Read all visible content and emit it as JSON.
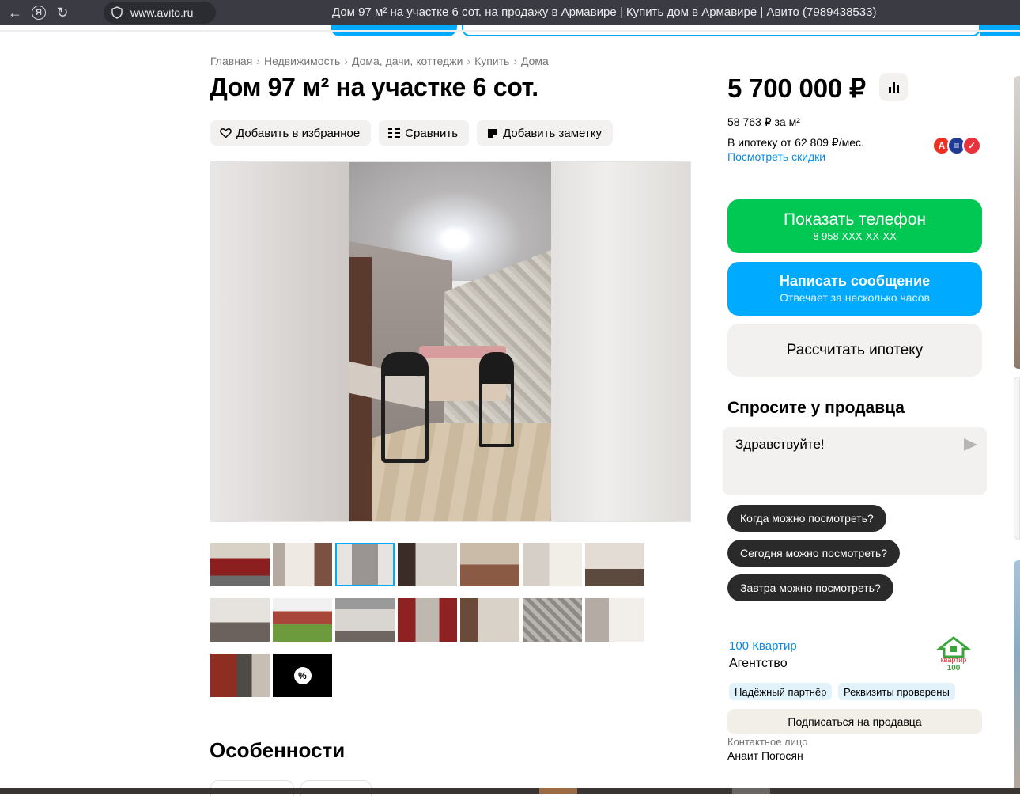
{
  "browser": {
    "url": "www.avito.ru",
    "tab_title": "Дом 97 м² на участке 6 сот. на продажу в Армавире | Купить дом в Армавире | Авито (7989438533)"
  },
  "breadcrumbs": [
    "Главная",
    "Недвижимость",
    "Дома, дачи, коттеджи",
    "Купить",
    "Дома"
  ],
  "listing": {
    "title": "Дом 97 м² на участке 6 сот.",
    "actions": {
      "favorite": "Добавить в избранное",
      "compare": "Сравнить",
      "note": "Добавить заметку"
    },
    "features_heading": "Особенности"
  },
  "price": {
    "value": "5 700 000 ₽",
    "per_m2": "58 763 ₽ за м²",
    "mortgage": "В ипотеку от 62 809 ₽/мес.",
    "discounts_link": "Посмотреть скидки"
  },
  "contact_buttons": {
    "phone_label": "Показать телефон",
    "phone_number": "8 958 XXX-XX-XX",
    "message_label": "Написать сообщение",
    "message_sub": "Отвечает за несколько часов",
    "mortgage_calc": "Рассчитать ипотеку"
  },
  "ask_seller": {
    "title": "Спросите у продавца",
    "message_value": "Здравствуйте!",
    "quick_questions": [
      "Когда можно посмотреть?",
      "Сегодня можно посмотреть?",
      "Завтра можно посмотреть?"
    ]
  },
  "seller": {
    "name": "100 Квартир",
    "type": "Агентство",
    "badges": [
      "Надёжный партнёр",
      "Реквизиты проверены"
    ],
    "subscribe": "Подписаться на продавца",
    "contact_label": "Контактное лицо",
    "contact_name": "Анаит Погосян",
    "logo_text_1": "квартир",
    "logo_text_2": "100"
  },
  "gallery": {
    "thumbnail_count": 16,
    "active_thumbnail": 3
  },
  "colors": {
    "accent_blue": "#00aaff",
    "phone_green": "#00c853",
    "link_blue": "#0a8ae6"
  }
}
